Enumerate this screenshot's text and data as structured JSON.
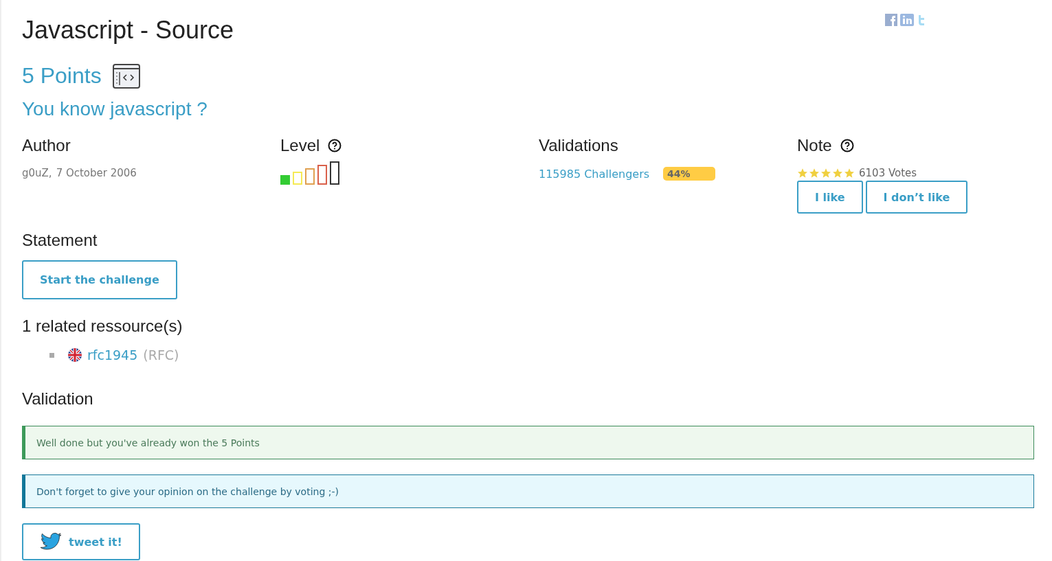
{
  "title": "Javascript - Source",
  "points": "5 Points",
  "subtitle": "You know javascript ?",
  "author": {
    "heading": "Author",
    "name": "g0uZ,",
    "date": "7 October 2006"
  },
  "level": {
    "heading": "Level",
    "bars": [
      {
        "filled": true,
        "color": "#33cc33"
      },
      {
        "filled": false,
        "color": "#f5ea55"
      },
      {
        "filled": false,
        "color": "#e0a050"
      },
      {
        "filled": false,
        "color": "#d9604a"
      },
      {
        "filled": false,
        "color": "#333333"
      }
    ]
  },
  "validations": {
    "heading": "Validations",
    "challengers": "115985 Challengers",
    "percent": "44%"
  },
  "note": {
    "heading": "Note",
    "stars": 5,
    "votes": "6103 Votes",
    "buttons": [
      "I like",
      "I don’t like"
    ]
  },
  "statement": {
    "heading": "Statement",
    "button": "Start the challenge"
  },
  "resources": {
    "heading": "1 related ressource(s)",
    "items": [
      {
        "link": "rfc1945",
        "type": "(RFC)"
      }
    ]
  },
  "validation": {
    "heading": "Validation",
    "messages": [
      {
        "kind": "success",
        "text": "Well done but you've already won the 5 Points"
      },
      {
        "kind": "info",
        "text": "Don't forget to give your opinion on the challenge by voting ;-)"
      }
    ],
    "tweet": "tweet it!"
  }
}
